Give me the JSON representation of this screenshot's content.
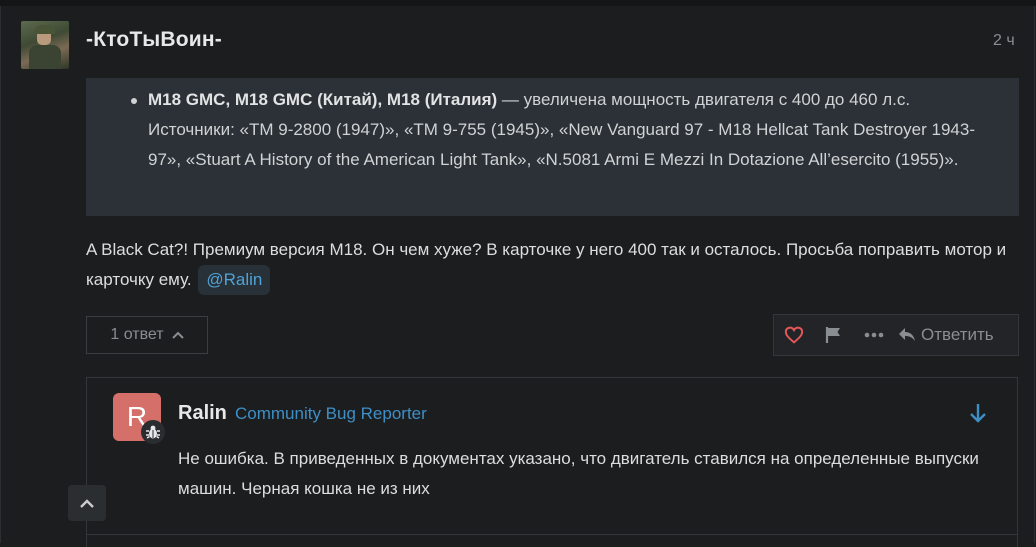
{
  "post": {
    "username": "-КтоТыВоин-",
    "time": "2 ч",
    "quote": {
      "bold": "M18 GMC, M18 GMC (Китай), M18 (Италия)",
      "text": " — увеличена мощность двигателя с 400 до 460 л.с. Источники: «TM 9-2800 (1947)», «TM 9-755 (1945)», «New Vanguard 97 - M18 Hellcat Tank Destroyer 1943-97», «Stuart A History of the American Light Tank», «N.5081 Armi E Mezzi In Dotazione All’esercito (1955)»."
    },
    "body": "A Black Cat?! Премиум версия M18. Он чем хуже? В карточке у него 400 так и осталось. Просьба поправить мотор и карточку ему.",
    "mention": "@Ralin",
    "replies_label": "1 ответ",
    "reply_label": "Ответить"
  },
  "reply": {
    "avatar_letter": "R",
    "avatar_color": "#d56f6a",
    "name": "Ralin",
    "title": "Community Bug Reporter",
    "text": "Не ошибка. В приведенных в документах указано, что двигатель ставился на определенные выпуски машин. Черная кошка не из них"
  },
  "colors": {
    "accent": "#3d8fc6",
    "like": "#e45757"
  }
}
